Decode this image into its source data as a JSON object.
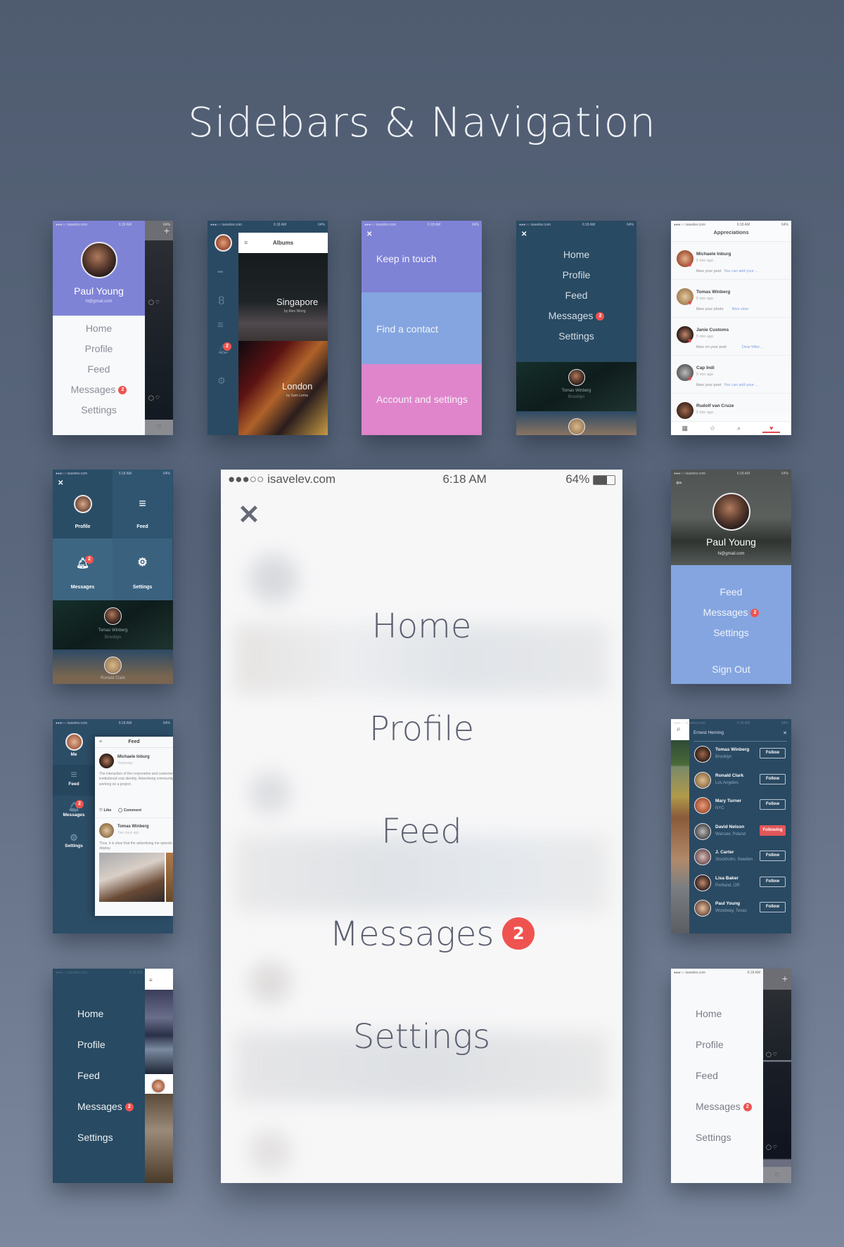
{
  "page": {
    "title": "Sidebars & Navigation"
  },
  "status_bar": {
    "carrier": "●●●○○ isavelev.com",
    "time": "6:18 AM",
    "battery": "64%"
  },
  "colors": {
    "badge": "#ef5350",
    "purple": "#7f83d6",
    "light_blue": "#84a5e0",
    "pink": "#e085cb",
    "navy": "#284a62",
    "following": "#e2575a"
  },
  "nav_items": [
    "Home",
    "Profile",
    "Feed",
    "Messages",
    "Settings"
  ],
  "messages_badge": "2",
  "card_profile_sidebar": {
    "name": "Paul Young",
    "email": "hi@gmail.com",
    "add_icon": "+"
  },
  "card_albums": {
    "header": "Albums",
    "albums": [
      {
        "title": "Singapore",
        "author": "by Alex Wong"
      },
      {
        "title": "London",
        "author": "by Sam Lema"
      }
    ],
    "notification_count": "2"
  },
  "card_blocks": {
    "close": "✕",
    "blocks": [
      "Keep in touch",
      "Find a contact",
      "Account and settings"
    ]
  },
  "card_navy_menu": {
    "close": "✕",
    "people": [
      {
        "name": "Tomas Winberg",
        "location": "Brooklyn"
      }
    ]
  },
  "card_appreciations": {
    "header": "Appreciations",
    "items": [
      {
        "name": "Michaele Inburg",
        "time": "5 min ago",
        "action": "likes your post",
        "link": "You can add your ..."
      },
      {
        "name": "Tomas Winberg",
        "time": "5 min ago",
        "action": "likes your photo",
        "link": "Nice view"
      },
      {
        "name": "Janie Customs",
        "time": "5 min ago",
        "action": "likes on your post",
        "link": "Dear Mike ..."
      },
      {
        "name": "Cap Indi",
        "time": "5 min ago",
        "action": "likes your post",
        "link": "You can add your ..."
      },
      {
        "name": "Rudolf van Cruze",
        "time": "5 min ago",
        "action": "",
        "link": ""
      }
    ]
  },
  "card_grid": {
    "close": "✕",
    "tiles": [
      "Profile",
      "Feed",
      "Messages",
      "Settings"
    ],
    "people": [
      {
        "name": "Tomas Winberg",
        "location": "Brooklyn"
      },
      {
        "name": "Ronald Clark",
        "location": ""
      }
    ]
  },
  "card_profile_header": {
    "name": "Paul Young",
    "email": "hi@gmail.com",
    "items": [
      "Feed",
      "Messages",
      "Settings"
    ],
    "sign_out": "Sign Out"
  },
  "big_menu": {
    "close": "✕",
    "items": [
      "Home",
      "Profile",
      "Feed",
      "Messages",
      "Settings"
    ],
    "badge": "2"
  },
  "card_feed": {
    "header": "Feed",
    "sidebar": [
      "Me",
      "Feed",
      "Messages",
      "Settings"
    ],
    "posts": [
      {
        "author": "Michaele Inburg",
        "time": "Yesterday",
        "text": "The interaction of the corporation and customer pushes the institutional corp identity. Advertising community induc display, working on a project.",
        "like": "Like",
        "comment": "Comment"
      },
      {
        "author": "Tomas Winberg",
        "time": "Two days ago",
        "text": "Thus, it is clear that the advertising me speeds typical banner display."
      }
    ]
  },
  "card_follow": {
    "search_value": "Ernest Heming",
    "people": [
      {
        "name": "Tomas Winberg",
        "location": "Brooklyn",
        "button": "Follow",
        "following": false
      },
      {
        "name": "Ronald Clark",
        "location": "Los Angeles",
        "button": "Follow",
        "following": false
      },
      {
        "name": "Mary Turner",
        "location": "NYC",
        "button": "Follow",
        "following": false
      },
      {
        "name": "David Nelson",
        "location": "Warsaw, Poland",
        "button": "Following",
        "following": true
      },
      {
        "name": "J. Carter",
        "location": "Stockholm, Sweden",
        "button": "Follow",
        "following": false
      },
      {
        "name": "Lisa Baker",
        "location": "Portland, OR",
        "button": "Follow",
        "following": false
      },
      {
        "name": "Paul Young",
        "location": "Woodway, Texas",
        "button": "Follow",
        "following": false
      }
    ]
  }
}
